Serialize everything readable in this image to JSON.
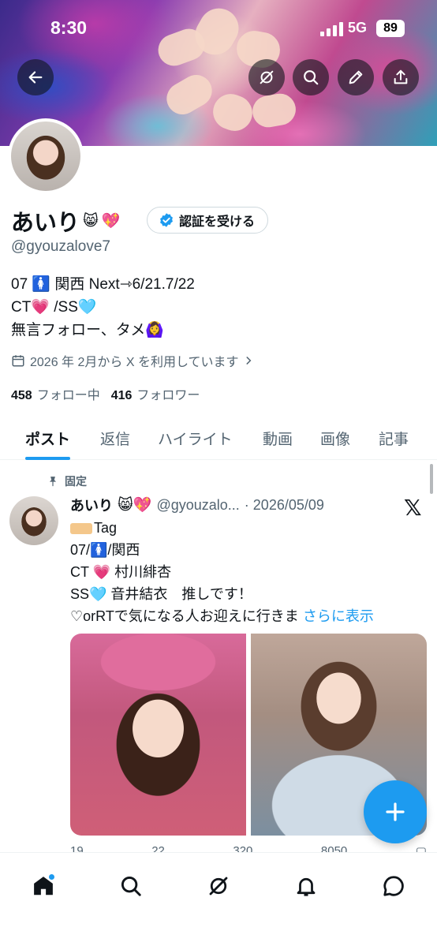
{
  "status_bar": {
    "time": "8:30",
    "network": "5G",
    "battery": "89"
  },
  "header": {
    "back_icon": "arrow-left-icon",
    "grok_icon": "grok-icon",
    "search_icon": "search-icon",
    "edit_icon": "pencil-icon",
    "share_icon": "share-icon"
  },
  "profile": {
    "name": "あいり",
    "name_emojis": [
      "😸",
      "💖"
    ],
    "verify_label": "認証を受ける",
    "handle": "@gyouzalove7",
    "bio": [
      "07 🚺 関西 Next⇾6/21.7/22",
      "CT💗 /SS🩵",
      "無言フォロー、タメ🙆‍♀️"
    ],
    "joined": "2026 年 2月から X を利用しています",
    "following_count": "458",
    "following_label": "フォロー中",
    "followers_count": "416",
    "followers_label": "フォロワー"
  },
  "tabs": [
    "ポスト",
    "返信",
    "ハイライト",
    "動画",
    "画像",
    "記事"
  ],
  "active_tab": "ポスト",
  "post": {
    "pinned_label": "固定",
    "author_name": "あいり",
    "author_emojis": "😸💖",
    "author_handle": "@gyouzalo...",
    "date": "· 2026/05/09",
    "lines": [
      "Tag",
      "07/🚺/関西",
      "CT 💗 村川緋杏",
      "SS🩵 音井結衣　推しです！",
      "♡orRTで気になる人お迎えに行きま"
    ],
    "more_label": "さらに表示",
    "actions": [
      "19",
      "22",
      "320",
      "8050"
    ]
  },
  "bottom_nav": [
    "home-icon",
    "search-icon",
    "grok-icon",
    "notifications-icon",
    "messages-icon"
  ],
  "colors": {
    "accent": "#1d9bf0",
    "text": "#0f1419",
    "secondary": "#536471"
  }
}
